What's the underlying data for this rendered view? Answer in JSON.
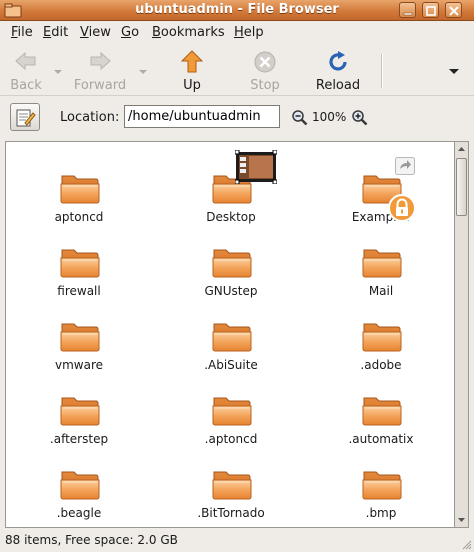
{
  "window": {
    "title": "ubuntuadmin - File Browser",
    "accent_color": "#d27a3b"
  },
  "menu": {
    "items": [
      {
        "label": "File",
        "mnemonic": "F",
        "rest": "ile"
      },
      {
        "label": "Edit",
        "mnemonic": "E",
        "rest": "dit"
      },
      {
        "label": "View",
        "mnemonic": "V",
        "rest": "iew"
      },
      {
        "label": "Go",
        "mnemonic": "G",
        "rest": "o"
      },
      {
        "label": "Bookmarks",
        "mnemonic": "B",
        "rest": "ookmarks"
      },
      {
        "label": "Help",
        "mnemonic": "H",
        "rest": "elp"
      }
    ]
  },
  "toolbar": {
    "back_label": "Back",
    "forward_label": "Forward",
    "up_label": "Up",
    "stop_label": "Stop",
    "reload_label": "Reload"
  },
  "location": {
    "label": "Location:",
    "path": "/home/ubuntuadmin",
    "zoom": "100%"
  },
  "files": [
    {
      "name": "aptoncd"
    },
    {
      "name": "Desktop",
      "emblem": "thumbnail"
    },
    {
      "name": "Examples",
      "emblem": "symlink-locked"
    },
    {
      "name": "firewall"
    },
    {
      "name": "GNUstep"
    },
    {
      "name": "Mail"
    },
    {
      "name": "vmware"
    },
    {
      "name": ".AbiSuite"
    },
    {
      "name": ".adobe"
    },
    {
      "name": ".afterstep"
    },
    {
      "name": ".aptoncd"
    },
    {
      "name": ".automatix"
    },
    {
      "name": ".beagle"
    },
    {
      "name": ".BitTornado"
    },
    {
      "name": ".bmp"
    }
  ],
  "status": {
    "text": "88 items, Free space: 2.0 GB"
  },
  "colors": {
    "folder_light": "#f6b36a",
    "folder_dark": "#e07b27"
  }
}
